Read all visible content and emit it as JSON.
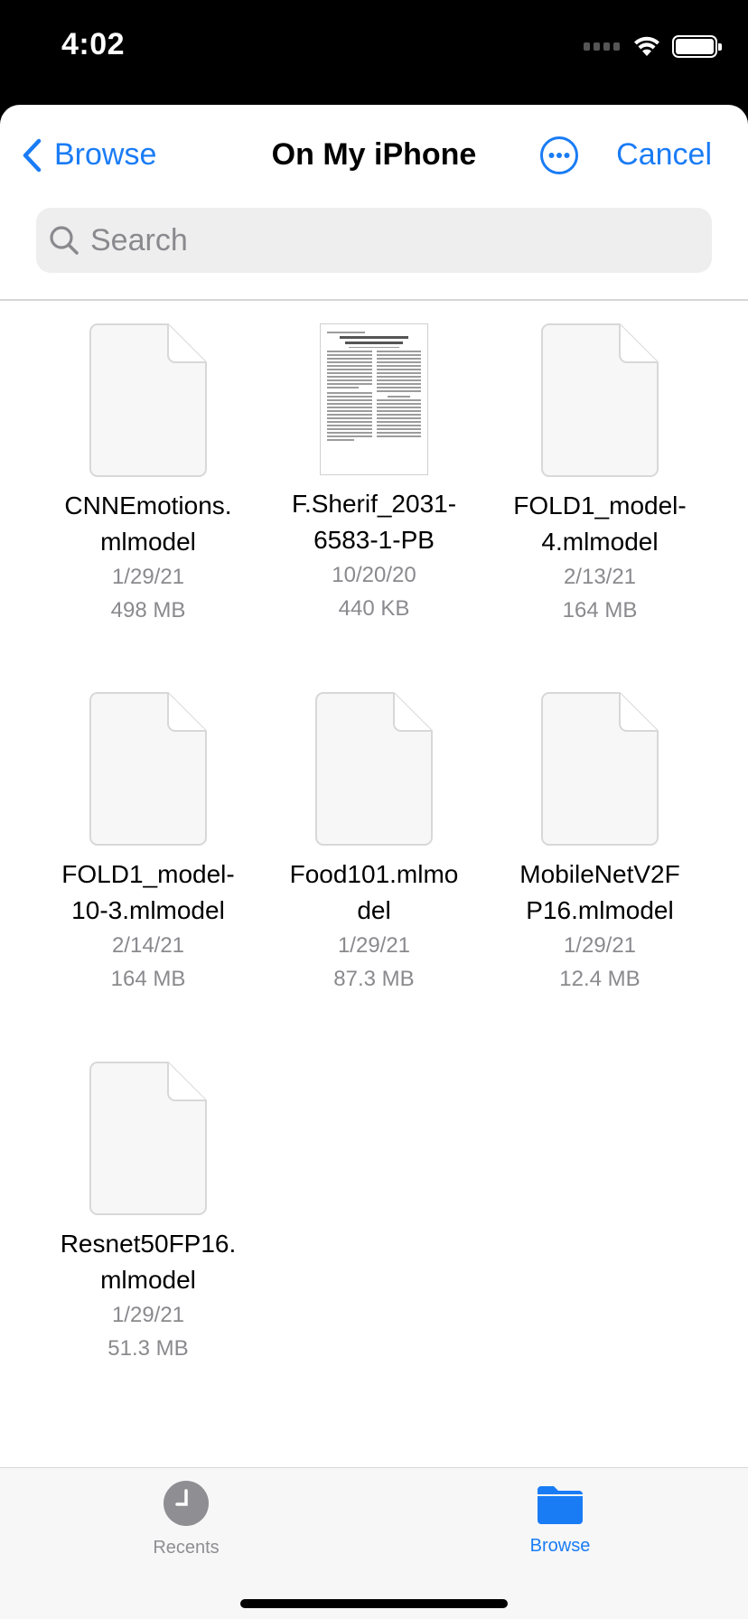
{
  "status_bar": {
    "time": "4:02"
  },
  "nav": {
    "back_label": "Browse",
    "title": "On My iPhone",
    "cancel_label": "Cancel"
  },
  "search": {
    "placeholder": "Search"
  },
  "files": [
    {
      "name": "CNNEmotions.\nmlmodel",
      "date": "1/29/21",
      "size": "498 MB",
      "icon": "generic-file-icon"
    },
    {
      "name": "F.Sherif_2031-\n6583-1-PB",
      "date": "10/20/20",
      "size": "440 KB",
      "icon": "pdf-thumbnail"
    },
    {
      "name": "FOLD1_model-\n4.mlmodel",
      "date": "2/13/21",
      "size": "164 MB",
      "icon": "generic-file-icon"
    },
    {
      "name": "FOLD1_model-\n10-3.mlmodel",
      "date": "2/14/21",
      "size": "164 MB",
      "icon": "generic-file-icon"
    },
    {
      "name": "Food101.mlmo\ndel",
      "date": "1/29/21",
      "size": "87.3 MB",
      "icon": "generic-file-icon"
    },
    {
      "name": "MobileNetV2F\nP16.mlmodel",
      "date": "1/29/21",
      "size": "12.4 MB",
      "icon": "generic-file-icon"
    },
    {
      "name": "Resnet50FP16.\nmlmodel",
      "date": "1/29/21",
      "size": "51.3 MB",
      "icon": "generic-file-icon"
    }
  ],
  "tabs": [
    {
      "label": "Recents",
      "icon": "clock-icon",
      "active": false
    },
    {
      "label": "Browse",
      "icon": "folder-icon",
      "active": true
    }
  ],
  "colors": {
    "accent": "#1a7cf5",
    "secondary_text": "#8a8a8e",
    "inactive_tab": "#8e8e93"
  }
}
